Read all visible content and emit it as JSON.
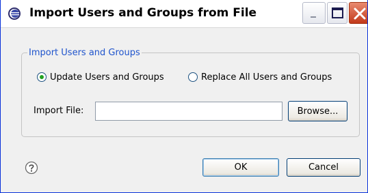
{
  "window": {
    "title": "Import Users and Groups from File",
    "icon": "eclipse-app-icon"
  },
  "group": {
    "legend": "Import Users and Groups",
    "options": [
      {
        "label": "Update Users and Groups",
        "selected": true
      },
      {
        "label": "Replace All Users and Groups",
        "selected": false
      }
    ],
    "import_file": {
      "label": "Import File:",
      "value": "",
      "placeholder": ""
    },
    "browse_label": "Browse..."
  },
  "footer": {
    "help_icon": "help-question-icon",
    "ok_label": "OK",
    "cancel_label": "Cancel"
  },
  "colors": {
    "legend_text": "#1f54cc",
    "radio_selected": "#21a121",
    "close_button": "#c2391a"
  }
}
